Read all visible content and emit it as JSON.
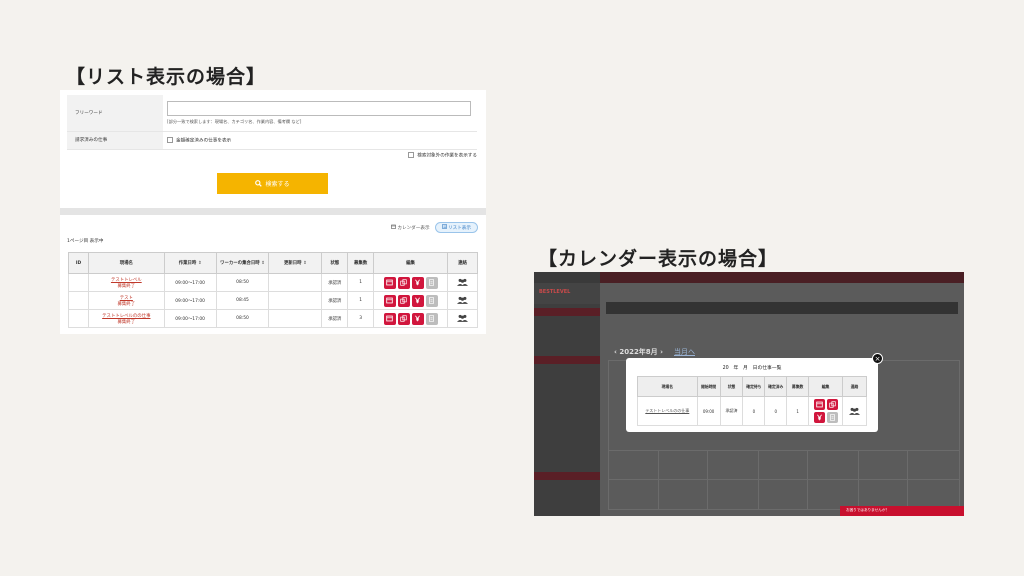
{
  "headings": {
    "list": "【リスト表示の場合】",
    "calendar": "【カレンダー表示の場合】"
  },
  "list_view": {
    "free_word_label": "フリーワード",
    "free_word_hint": "[部分一致で検索します：現場名、カテゴリ名、作業内容、備考欄 など]",
    "billed_label": "請求済みの仕事",
    "billed_checkbox": "金額確定済みの仕事を表示",
    "show_excluded": "検索対象外の作業を表示する",
    "search_button": "検索する",
    "calendar_view": "カレンダー表示",
    "list_view": "リスト表示",
    "page_info": "1ページ目 表示中",
    "columns": [
      "ID",
      "現場名",
      "作業日時",
      "ワーカーの集合日時",
      "更新日時",
      "状態",
      "募集数",
      "編集",
      "連絡"
    ],
    "rows": [
      {
        "id": "",
        "site": "テストトレベル",
        "sub": "募集終了",
        "work": "09:00〜17:00",
        "gather": "08:50",
        "updated": "",
        "status": "承認済",
        "count": "1"
      },
      {
        "id": "",
        "site": "テスト",
        "sub": "募集終了",
        "work": "09:00〜17:00",
        "gather": "08:45",
        "updated": "",
        "status": "承認済",
        "count": "1"
      },
      {
        "id": "",
        "site": "テストトレベルのの仕事",
        "sub": "募集終了",
        "work": "09:00〜17:00",
        "gather": "08:50",
        "updated": "",
        "status": "承認済",
        "count": "3"
      }
    ]
  },
  "calendar_view": {
    "logo": "BESTLEVEL",
    "month": "2022年8月",
    "today_link": "当月へ",
    "modal_title": "20　年　月　日の仕事一覧",
    "modal_columns": [
      "現場名",
      "開始時間",
      "状態",
      "確定待ち",
      "確定済み",
      "募集数",
      "編集",
      "連絡"
    ],
    "modal_row": {
      "site": "テストトレベルのの仕事",
      "start": "09:00",
      "status": "承認済",
      "pending": "0",
      "confirmed": "0",
      "count": "1"
    },
    "bottom_banner": "お困りではありませんか？",
    "close": "×"
  }
}
